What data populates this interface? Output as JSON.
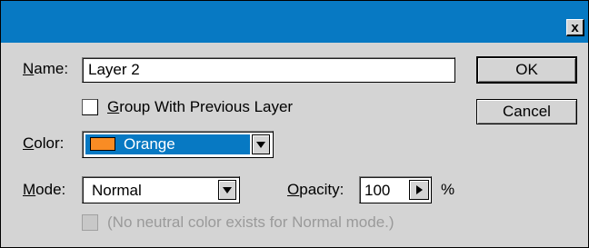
{
  "window": {
    "close_glyph": "x"
  },
  "name_field": {
    "label_mnemonic": "N",
    "label_rest": "ame:",
    "value": "Layer 2"
  },
  "group_checkbox": {
    "label_mnemonic": "G",
    "label_rest": "roup With Previous Layer",
    "checked": false
  },
  "color_field": {
    "label_mnemonic": "C",
    "label_rest": "olor:",
    "value": "Orange",
    "swatch_color": "#f98c24",
    "highlight_color": "#0779c3"
  },
  "mode_field": {
    "label_mnemonic": "M",
    "label_rest": "ode:",
    "value": "Normal"
  },
  "opacity_field": {
    "label_mnemonic": "O",
    "label_rest": "pacity:",
    "value": "100",
    "unit": "%"
  },
  "neutral_checkbox": {
    "label": "(No neutral color exists for Normal mode.)",
    "enabled": false
  },
  "buttons": {
    "ok": "OK",
    "cancel": "Cancel"
  }
}
